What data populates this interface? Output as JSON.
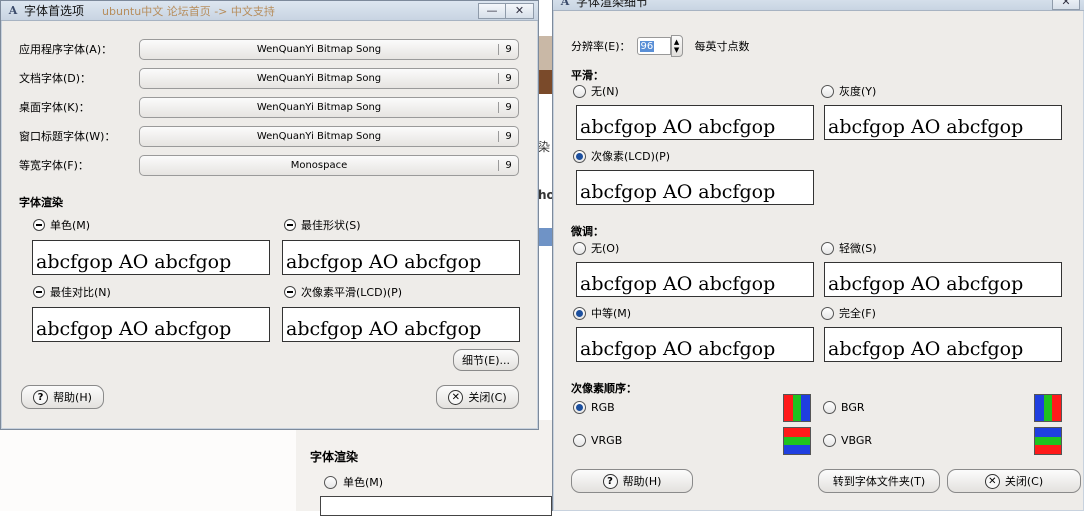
{
  "background": {
    "tab_fragment": "ubuntu中文 论坛首页 -> 中文支持",
    "side_text_a": "染",
    "side_text_b": "ho",
    "frag_title": "字体渲染",
    "frag_option": "单色(M)"
  },
  "left_window": {
    "title": "字体首选项",
    "controls": {
      "minimize": "—",
      "close": "✕"
    },
    "font_rows": [
      {
        "label": "应用程序字体(A)：",
        "font": "WenQuanYi Bitmap Song",
        "size": "9"
      },
      {
        "label": "文档字体(D)：",
        "font": "WenQuanYi Bitmap Song",
        "size": "9"
      },
      {
        "label": "桌面字体(K)：",
        "font": "WenQuanYi Bitmap Song",
        "size": "9"
      },
      {
        "label": "窗口标题字体(W)：",
        "font": "WenQuanYi Bitmap Song",
        "size": "9"
      },
      {
        "label": "等宽字体(F)：",
        "font": "Monospace",
        "size": "9"
      }
    ],
    "render_title": "字体渲染",
    "render_options": [
      {
        "label": "单色(M)",
        "sample": "abcfgop AO abcfgop"
      },
      {
        "label": "最佳形状(S)",
        "sample": "abcfgop AO abcfgop"
      },
      {
        "label": "最佳对比(N)",
        "sample": "abcfgop AO abcfgop"
      },
      {
        "label": "次像素平滑(LCD)(P)",
        "sample": "abcfgop AO abcfgop"
      }
    ],
    "details_button": "细节(E)...",
    "help_button": "帮助(H)",
    "close_button": "关闭(C)"
  },
  "right_window": {
    "title": "字体渲染细节",
    "controls": {
      "close": "✕"
    },
    "dpi_label": "分辨率(E)：",
    "dpi_value": "96",
    "dpi_unit": "每英寸点数",
    "smoothing_title": "平滑：",
    "smoothing": [
      {
        "label": "无(N)",
        "selected": false,
        "sample": "abcfgop AO abcfgop"
      },
      {
        "label": "灰度(Y)",
        "selected": false,
        "sample": "abcfgop AO abcfgop"
      },
      {
        "label": "次像素(LCD)(P)",
        "selected": true,
        "sample": "abcfgop AO abcfgop"
      }
    ],
    "hinting_title": "微调：",
    "hinting": [
      {
        "label": "无(O)",
        "selected": false,
        "sample": "abcfgop AO abcfgop"
      },
      {
        "label": "轻微(S)",
        "selected": false,
        "sample": "abcfgop AO abcfgop"
      },
      {
        "label": "中等(M)",
        "selected": true,
        "sample": "abcfgop AO abcfgop"
      },
      {
        "label": "完全(F)",
        "selected": false,
        "sample": "abcfgop AO abcfgop"
      }
    ],
    "subpixel_title": "次像素顺序：",
    "subpixel": [
      {
        "label": "RGB",
        "selected": true
      },
      {
        "label": "BGR",
        "selected": false
      },
      {
        "label": "VRGB",
        "selected": false
      },
      {
        "label": "VBGR",
        "selected": false
      }
    ],
    "help_button": "帮助(H)",
    "goto_button": "转到字体文件夹(T)",
    "close_button": "关闭(C)",
    "colors": {
      "red": "#ff1a1a",
      "green": "#1fc21f",
      "blue": "#1f3fe0"
    }
  }
}
